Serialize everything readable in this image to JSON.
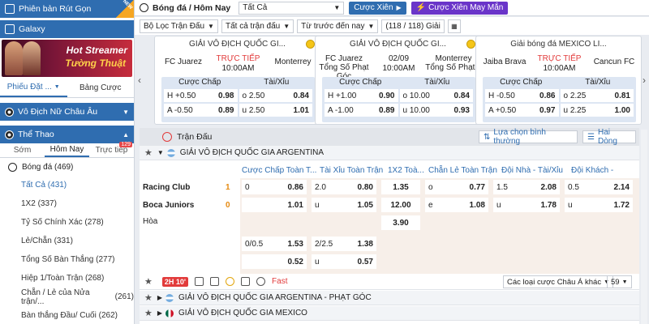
{
  "sidebar": {
    "rut_gon": "Phiên bản Rút Gọn",
    "new_badge": "NEW",
    "galaxy": "Galaxy",
    "banner_line1": "Hot Streamer",
    "banner_line2": "Tường Thuật",
    "tab_phieu": "Phiếu Đặt ...",
    "tab_bang": "Bảng Cược",
    "womens_euro": "Vô Địch Nữ Châu Âu",
    "the_thao": "Thể Thao",
    "sub_som": "Sớm",
    "sub_hom_nay": "Hôm Nay",
    "sub_truc_tiep": "Trực tiếp",
    "live_count": "129",
    "sport": "Bóng đá",
    "sport_count": "(469)",
    "items": [
      {
        "label": "Tất Cả",
        "count": "(431)"
      },
      {
        "label": "1X2",
        "count": "(337)"
      },
      {
        "label": "Tỷ Số Chính Xác",
        "count": "(278)"
      },
      {
        "label": "Lẻ/Chẵn",
        "count": "(331)"
      },
      {
        "label": "Tổng Số Bàn Thắng",
        "count": "(277)"
      },
      {
        "label": "Hiệp 1/Toàn Trận",
        "count": "(268)"
      },
      {
        "label": "Chẵn / Lẻ của Nửa trận/...",
        "count": "(261)"
      },
      {
        "label": "Bàn thắng Đầu/ Cuối",
        "count": "(262)"
      }
    ]
  },
  "topbar": {
    "title": "Bóng đá / Hôm Nay",
    "select_value": "Tất Cả",
    "cuoc_xien": "Cược Xiên",
    "cuoc_xien_may_man": "Cược Xiên May Mắn"
  },
  "filters": {
    "bo_loc": "Bộ Lọc Trận Đấu",
    "tat_ca_tran": "Tất cả trận đấu",
    "tu_truoc": "Từ trước đến nay",
    "giai_count": "(118 / 118) Giải"
  },
  "cards": [
    {
      "league": "GIẢI VÔ ĐỊCH QUỐC GI...",
      "home": "FC Juarez",
      "away": "Monterrey",
      "status": "TRỰC TIẾP",
      "time": "10:00AM",
      "h_label": "Cược Chấp",
      "ou_label": "Tài/Xỉu",
      "rows": [
        {
          "hs": "H",
          "hl": "+0.50",
          "hv": "0.98",
          "os": "o",
          "ol": "2.50",
          "ov": "0.84"
        },
        {
          "hs": "A",
          "hl": "-0.50",
          "hv": "0.89",
          "os": "u",
          "ol": "2.50",
          "ov": "1.01"
        }
      ]
    },
    {
      "league": "GIẢI VÔ ĐỊCH QUỐC GI...",
      "home": "FC Juarez Tổng Số Phạt Góc",
      "away": "Monterrey Tổng Số Phạt...",
      "status": "02/09",
      "time": "10:00AM",
      "h_label": "Cược Chấp",
      "ou_label": "Tài/Xỉu",
      "rows": [
        {
          "hs": "H",
          "hl": "+1.00",
          "hv": "0.90",
          "os": "o",
          "ol": "10.00",
          "ov": "0.84"
        },
        {
          "hs": "A",
          "hl": "-1.00",
          "hv": "0.89",
          "os": "u",
          "ol": "10.00",
          "ov": "0.93"
        }
      ]
    },
    {
      "league": "Giải bóng đá MEXICO LI...",
      "home": "Jaiba Brava",
      "away": "Cancun FC",
      "status": "TRỰC TIẾP",
      "time": "10:00AM",
      "h_label": "Cược Chấp",
      "ou_label": "Tài/Xỉu",
      "rows": [
        {
          "hs": "H",
          "hl": "-0.50",
          "hv": "0.86",
          "os": "o",
          "ol": "2.25",
          "ov": "0.81"
        },
        {
          "hs": "A",
          "hl": "+0.50",
          "hv": "0.97",
          "os": "u",
          "ol": "2.25",
          "ov": "1.00"
        }
      ]
    }
  ],
  "main": {
    "header_title": "Trận Đấu",
    "sort_select": "Lựa chọn bình thường",
    "lines_select": "Hai Dòng",
    "league1": "GIẢI VÔ ĐỊCH QUỐC GIA ARGENTINA",
    "columns": [
      "Cược Chấp Toàn T...",
      "Tài Xỉu Toàn Trận",
      "1X2 Toà...",
      "Chẵn Lẻ Toàn Trận",
      "Đội Nhà - Tài/Xỉu",
      "Đội Khách - Tài/Xỉu"
    ],
    "home": "Racing Club",
    "home_score": "1",
    "away": "Boca Juniors",
    "away_score": "0",
    "draw": "Hòa",
    "odds": {
      "r1": {
        "ah_l": "0",
        "ah_v": "0.86",
        "ou_l": "2.0",
        "ou_v": "0.80",
        "x1": "1.35",
        "oe_l": "o",
        "oe_v": "0.77",
        "hou_l": "1.5",
        "hou_v": "2.08",
        "aou_l": "0.5",
        "aou_v": "2.14"
      },
      "r2": {
        "ah_v": "1.01",
        "ou_l": "u",
        "ou_v": "1.05",
        "x2": "12.00",
        "oe_l": "e",
        "oe_v": "1.08",
        "hou_l": "u",
        "hou_v": "1.78",
        "aou_l": "u",
        "aou_v": "1.72"
      },
      "r3": {
        "xd": "3.90"
      },
      "r4": {
        "ah_l": "0/0.5",
        "ah_v": "1.53",
        "ou_l": "2/2.5",
        "ou_v": "1.38"
      },
      "r5": {
        "ah_v": "0.52",
        "ou_l": "u",
        "ou_v": "0.57"
      }
    },
    "live_time": "2H 10'",
    "fast": "Fast",
    "other_bets": "Các loại cược Châu Á khác",
    "other_count": "59",
    "league2": "GIẢI VÔ ĐỊCH QUỐC GIA ARGENTINA - PHẠT GÓC",
    "league3": "GIẢI VÔ ĐỊCH QUỐC GIA MEXICO"
  }
}
